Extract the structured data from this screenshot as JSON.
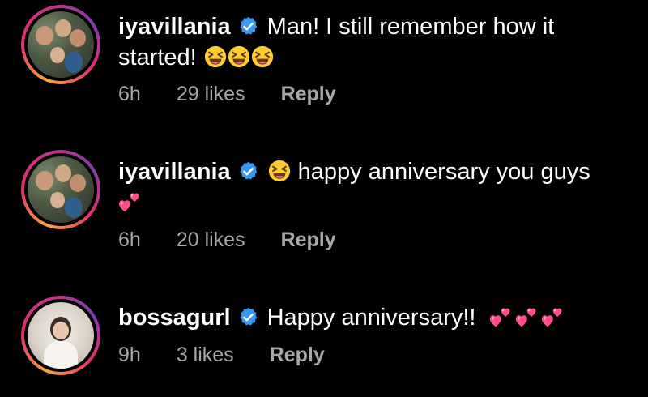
{
  "comments": [
    {
      "username": "iyavillania",
      "text_before": "Man! I still remember how it started!",
      "text_after": "",
      "emojis_inline": [
        "grinning-squinting-face",
        "grinning-squinting-face",
        "grinning-squinting-face"
      ],
      "time": "6h",
      "likes": "29 likes",
      "reply": "Reply"
    },
    {
      "username": "iyavillania",
      "text_before": "",
      "text_after": "happy anniversary you guys",
      "emojis_inline": [
        "grinning-squinting-face",
        "two-hearts"
      ],
      "time": "6h",
      "likes": "20 likes",
      "reply": "Reply"
    },
    {
      "username": "bossagurl",
      "text_before": "Happy anniversary!!",
      "text_after": "",
      "emojis_inline": [
        "two-hearts",
        "two-hearts",
        "two-hearts"
      ],
      "time": "9h",
      "likes": "3 likes",
      "reply": "Reply"
    }
  ],
  "colors": {
    "background": "#000000",
    "text": "#ffffff",
    "meta": "#a8a8a8",
    "verified": "#3897f0",
    "heart": "#ff4f8b"
  }
}
